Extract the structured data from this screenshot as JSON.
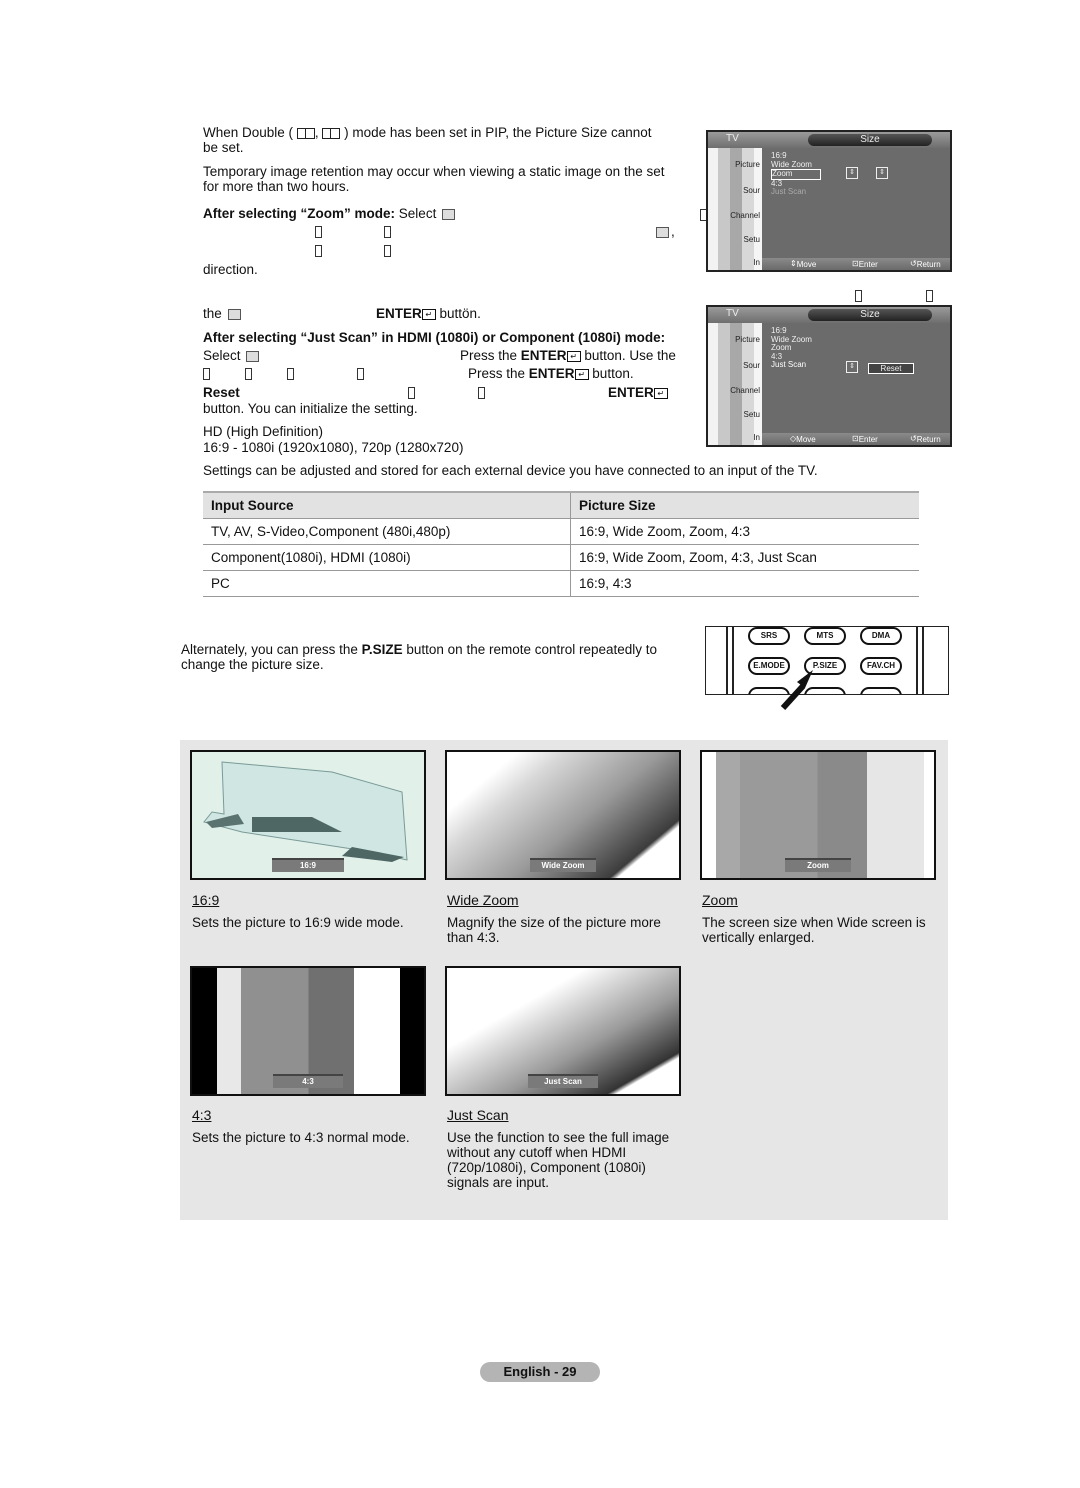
{
  "notes": {
    "double_mode_a": "When Double (",
    "double_mode_sep": ",",
    "double_mode_b": ") mode has been set in PIP, the Picture Size cannot",
    "double_mode_c": "be set.",
    "retention_a": "Temporary image retention may occur when viewing a static image on the set",
    "retention_b": "for more than two hours."
  },
  "zoom_section": {
    "heading": "After selecting “Zoom” mode:",
    "select_text": "Select",
    "direction_text": "direction.",
    "the_text": "the",
    "enter_label": "ENTER",
    "button_text": "buttön."
  },
  "just_scan_section": {
    "heading": "After selecting “Just Scan” in HDMI (1080i) or Component (1080i) mode:",
    "select_text": "Select",
    "press_enter_a": "Press ",
    "press_enter_b": "the ",
    "enter_label": "ENTER",
    "use_the": " button. Use the",
    "press_the": "Press the ",
    "button_period": " button.",
    "reset_label": "Reset",
    "init_text": "button. You can initialize the setting.",
    "hd_title": "HD (High Definition)",
    "hd_detail": "16:9 - 1080i (1920x1080), 720p (1280x720)"
  },
  "settings_note": "Settings can be adjusted and stored for each external device you have connected to an input of the TV.",
  "osd_zoom": {
    "tv_label": "TV",
    "title": "Size",
    "side_items": [
      "Picture",
      "Sour",
      "Channel",
      "Setu",
      "In"
    ],
    "items": [
      "16:9",
      "Wide Zoom",
      "Zoom",
      "4:3",
      "Just Scan"
    ],
    "selected": "Zoom",
    "move": "Move",
    "enter": "Enter",
    "return": "Return"
  },
  "osd_justscan": {
    "tv_label": "TV",
    "title": "Size",
    "side_items": [
      "Picture",
      "Sour",
      "Channel",
      "Setu",
      "In"
    ],
    "items": [
      "16:9",
      "Wide Zoom",
      "Zoom",
      "4:3",
      "Just Scan"
    ],
    "selected": "Just Scan",
    "reset": "Reset",
    "move": "Move",
    "enter": "Enter",
    "return": "Return"
  },
  "table": {
    "headers": [
      "Input Source",
      "Picture Size"
    ],
    "rows": [
      [
        "TV, AV, S-Video,Component (480i,480p)",
        "16:9, Wide Zoom, Zoom, 4:3"
      ],
      [
        "Component(1080i), HDMI (1080i)",
        "16:9, Wide Zoom, Zoom, 4:3, Just Scan"
      ],
      [
        "PC",
        "16:9, 4:3"
      ]
    ]
  },
  "psize": {
    "text_a": "Alternately, you can press the ",
    "key": "P.SIZE",
    "text_b": " button on the remote control repeatedly to",
    "text_c": "change the picture size.",
    "remote_buttons": [
      "SRS",
      "MTS",
      "DMA",
      "E.MODE",
      "P.SIZE",
      "FAV.CH"
    ]
  },
  "gallery": [
    {
      "label": "16:9",
      "title": "16:9",
      "desc": "Sets the picture to 16:9 wide mode."
    },
    {
      "label": "Wide Zoom",
      "title": "Wide Zoom",
      "desc": "Magnify the size of the picture more than 4:3."
    },
    {
      "label": "Zoom",
      "title": "Zoom",
      "desc": "The screen size when Wide screen is vertically enlarged."
    },
    {
      "label": "4:3",
      "title": "4:3",
      "desc": "Sets the picture to 4:3 normal mode."
    },
    {
      "label": "Just Scan",
      "title": "Just Scan",
      "desc": "Use the function to see the full image without any cutoff when HDMI (720p/1080i), Component (1080i) signals are input."
    }
  ],
  "footer": {
    "page_label": "English - 29"
  }
}
